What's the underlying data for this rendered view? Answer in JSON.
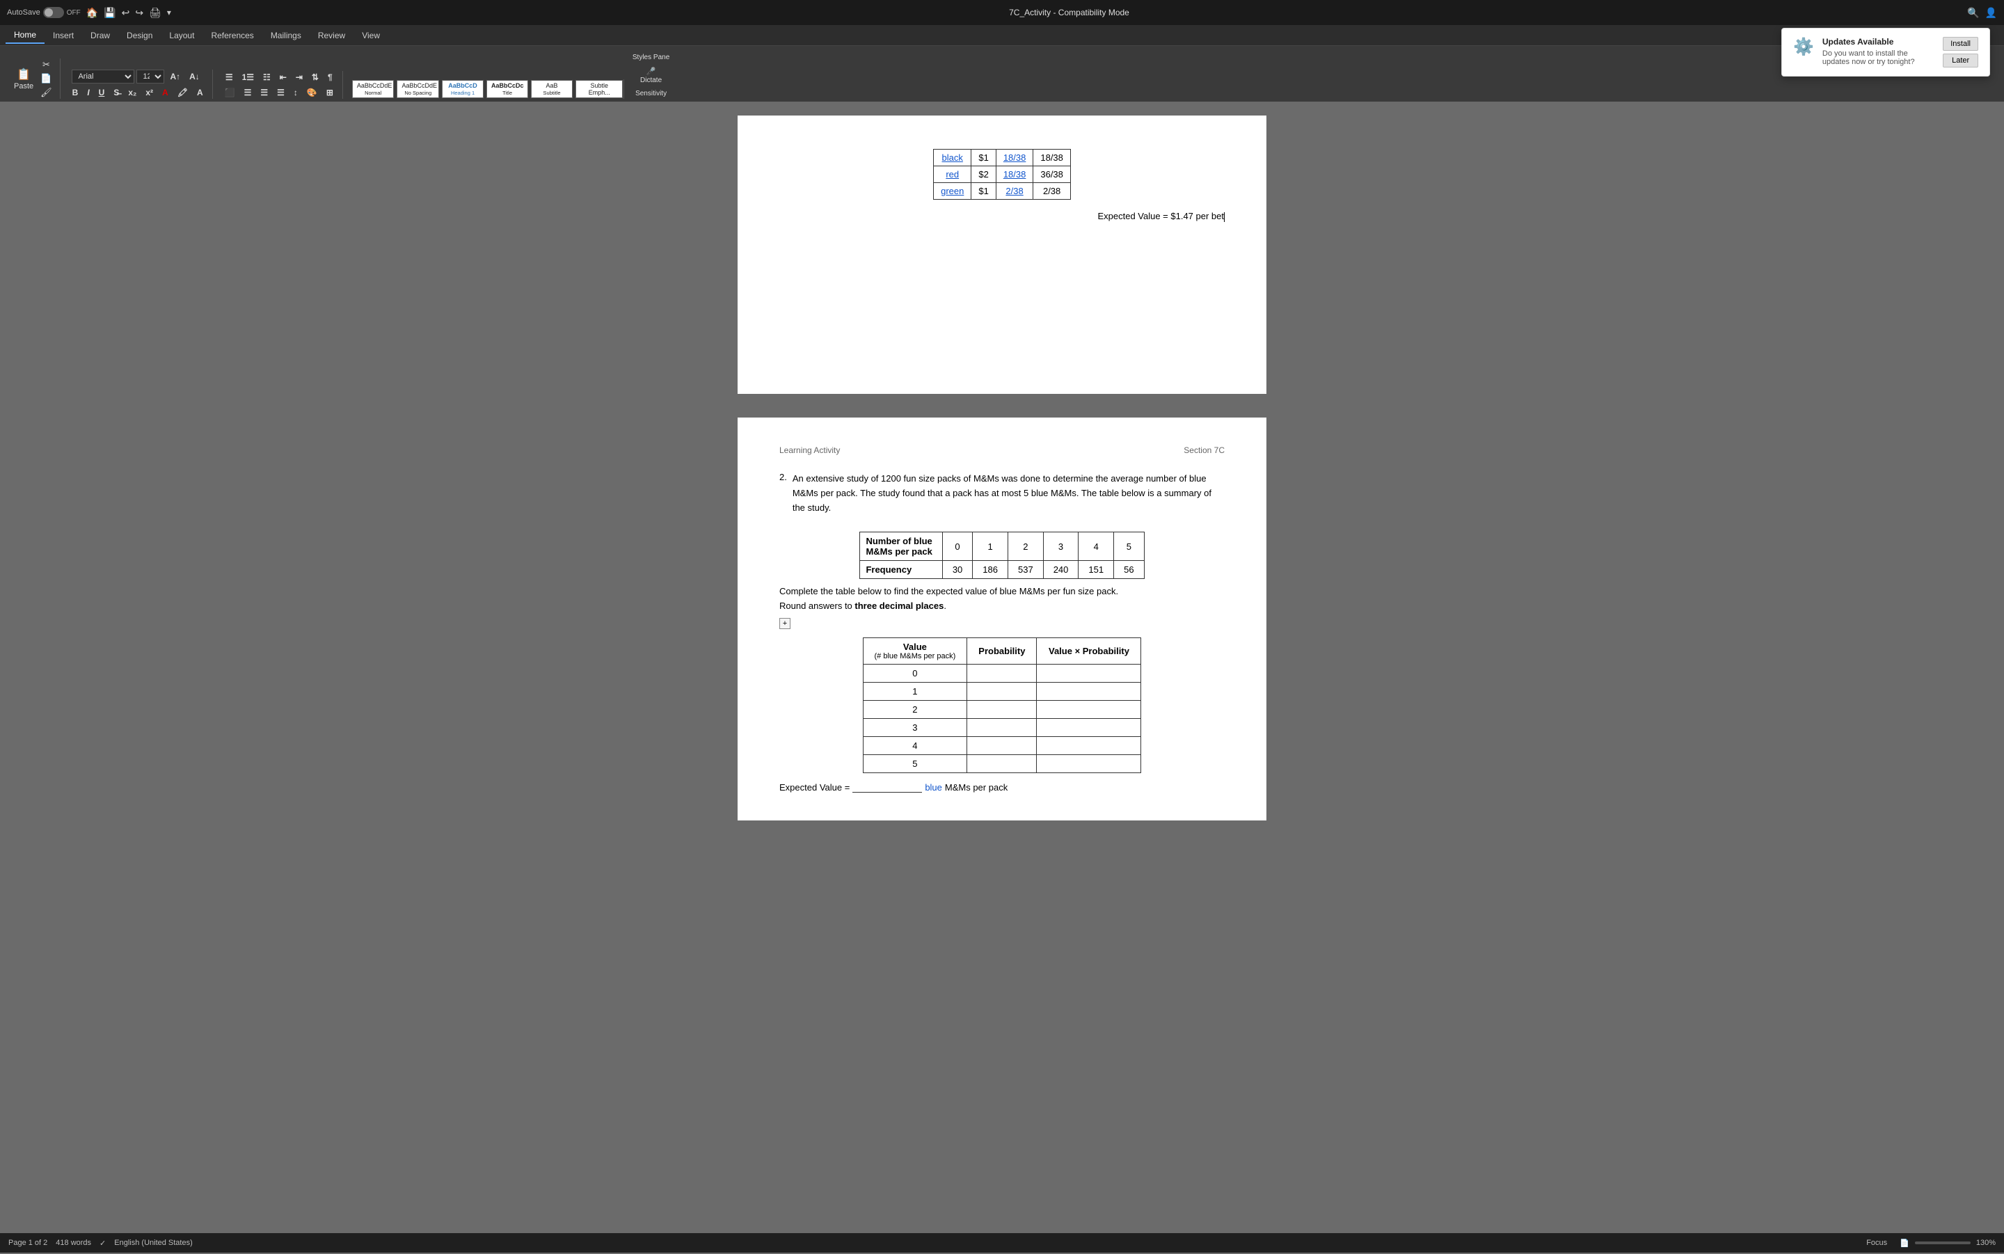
{
  "titleBar": {
    "autosave": "AutoSave",
    "autosaveState": "OFF",
    "title": "7C_Activity  -  Compatibility Mode",
    "searchPlaceholder": "🔍"
  },
  "ribbon": {
    "tabs": [
      "Home",
      "Insert",
      "Draw",
      "Design",
      "Layout",
      "References",
      "Mailings",
      "Review",
      "View"
    ],
    "activeTab": "Home",
    "fontName": "Arial",
    "fontSize": "12",
    "styles": [
      {
        "label": "AaBbCcDdE",
        "name": "Normal"
      },
      {
        "label": "AaBbCcDdE",
        "name": "No Spacing"
      },
      {
        "label": "AaBbCcD",
        "name": "Heading 1"
      },
      {
        "label": "AaBbCcDc",
        "name": "Title"
      },
      {
        "label": "AaB",
        "name": "Subtitle"
      },
      {
        "label": "Subtle Emph...",
        "name": "Subtle Emph..."
      }
    ],
    "buttons": {
      "stylesPane": "Styles Pane",
      "dictate": "Dictate",
      "sensitivity": "Sensitivity"
    }
  },
  "page1": {
    "table": {
      "rows": [
        {
          "color": "black",
          "value": "$1",
          "probability": "18/38",
          "valueProbability": "18/38"
        },
        {
          "color": "red",
          "value": "$2",
          "probability": "18/38",
          "valueProbability": "36/38"
        },
        {
          "color": "green",
          "value": "$1",
          "probability": "2/38",
          "valueProbability": "2/38"
        }
      ]
    },
    "expectedValue": "Expected Value = $1.47 per bet"
  },
  "page2": {
    "headerLeft": "Learning Activity",
    "headerRight": "Section 7C",
    "problemNumber": "2.",
    "problemText": "An extensive study of 1200 fun size packs of M&Ms was done to determine the average number of blue M&Ms per pack. The study found that a pack has at most 5 blue M&Ms. The table below is a summary of the study.",
    "summaryTable": {
      "headers": [
        "Number of blue M&Ms per pack",
        "0",
        "1",
        "2",
        "3",
        "4",
        "5"
      ],
      "row": [
        "Frequency",
        "30",
        "186",
        "537",
        "240",
        "151",
        "56"
      ]
    },
    "instructionText": "Complete the table below to find the expected value of blue M&Ms per fun size pack.",
    "roundText": "Round answers to ",
    "roundBold": "three decimal places",
    "roundEnd": ".",
    "completeTable": {
      "headers": [
        "Value\n(# blue M&Ms per pack)",
        "Probability",
        "Value × Probability"
      ],
      "rows": [
        "0",
        "1",
        "2",
        "3",
        "4",
        "5"
      ]
    },
    "expectedValueLine": "Expected Value = ",
    "expectedValueBlank": "",
    "expectedValueBlueWord": "blue",
    "expectedValueEnd": " M&Ms per pack"
  },
  "statusBar": {
    "pageInfo": "Page 1 of 2",
    "wordCount": "418 words",
    "language": "English (United States)",
    "focusMode": "Focus",
    "zoom": "130%"
  },
  "notification": {
    "title": "Updates Available",
    "text": "Do you want to install the updates now or try tonight?",
    "installBtn": "Install",
    "laterBtn": "Later"
  }
}
